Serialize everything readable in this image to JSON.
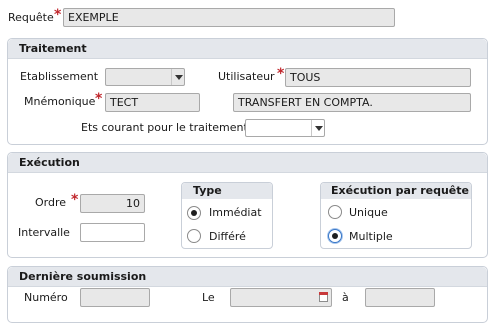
{
  "header": {
    "requete_label": "Requête",
    "requete_value": "EXEMPLE",
    "required_mark": "*"
  },
  "traitement": {
    "title": "Traitement",
    "etablissement_label": "Etablissement",
    "etablissement_value": "",
    "utilisateur_label": "Utilisateur",
    "utilisateur_value": "TOUS",
    "mnemonique_label": "Mnémonique",
    "mnemonique_value": "TECT",
    "mnemonique_desc": "TRANSFERT EN COMPTA.",
    "ets_courant_label": "Ets courant pour le traitement",
    "ets_courant_value": ""
  },
  "execution": {
    "title": "Exécution",
    "ordre_label": "Ordre",
    "ordre_value": "10",
    "intervalle_label": "Intervalle",
    "intervalle_value": "",
    "type": {
      "title": "Type",
      "options": [
        {
          "label": "Immédiat",
          "selected": true
        },
        {
          "label": "Différé",
          "selected": false
        }
      ]
    },
    "par_requete": {
      "title": "Exécution par requête",
      "options": [
        {
          "label": "Unique",
          "selected": false
        },
        {
          "label": "Multiple",
          "selected": true
        }
      ]
    }
  },
  "derniere_soumission": {
    "title": "Dernière soumission",
    "numero_label": "Numéro",
    "numero_value": "",
    "le_label": "Le",
    "le_value": "",
    "a_label": "à",
    "a_value": ""
  },
  "icons": {
    "calendar": "calendar-icon",
    "dropdown": "chevron-down-icon"
  },
  "colors": {
    "required": "#c0262c",
    "panel_header": "#e4e7ec",
    "field_disabled": "#e8e8e8"
  }
}
